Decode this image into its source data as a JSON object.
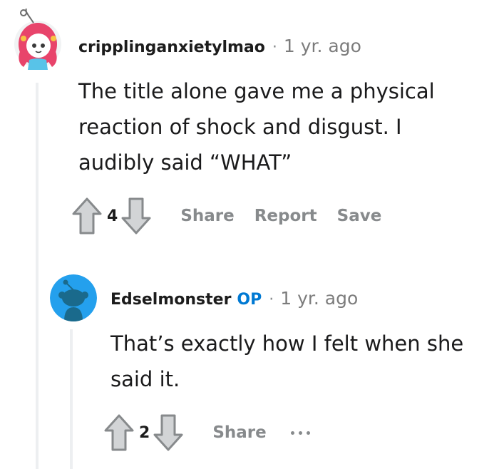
{
  "comments": [
    {
      "username": "cripplinganxietylmao",
      "separator": "·",
      "time": "1 yr. ago",
      "body": "The title alone gave me a physical reaction of shock and disgust. I audibly said “WHAT”",
      "score": "4",
      "actions": [
        "Share",
        "Report",
        "Save"
      ],
      "avatar_icon": "snoo-avatar-pink-hair"
    },
    {
      "username": "Edselmonster",
      "badge": "OP",
      "separator": "·",
      "time": "1 yr. ago",
      "body": "That’s exactly how I felt when she said it.",
      "score": "2",
      "actions": [
        "Share"
      ],
      "more_icon": "ellipsis-icon",
      "avatar_icon": "default-snoo-avatar"
    }
  ],
  "colors": {
    "op_badge": "#0079d3",
    "muted_text": "#878a8c",
    "thread_line": "#edeff1",
    "default_avatar_bg": "#24a0ed"
  }
}
